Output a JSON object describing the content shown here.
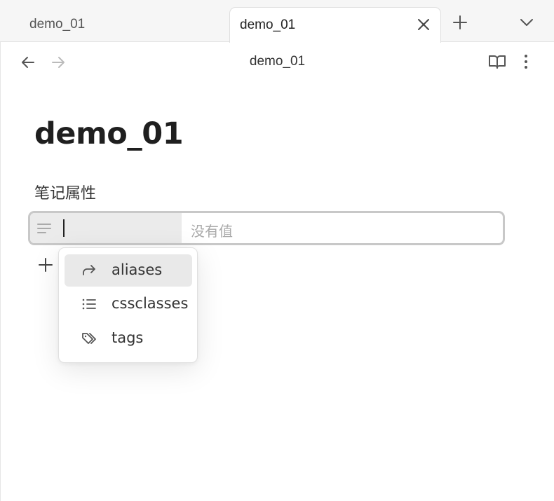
{
  "tabs": [
    {
      "label": "demo_01",
      "active": false
    },
    {
      "label": "demo_01",
      "active": true
    }
  ],
  "nav": {
    "title": "demo_01"
  },
  "note": {
    "title": "demo_01"
  },
  "properties": {
    "heading": "笔记属性",
    "key_value": "",
    "value_placeholder": "没有值"
  },
  "suggestions": [
    {
      "label": "aliases",
      "icon": "forward-arrow-icon",
      "selected": true
    },
    {
      "label": "cssclasses",
      "icon": "list-icon",
      "selected": false
    },
    {
      "label": "tags",
      "icon": "tags-icon",
      "selected": false
    }
  ],
  "colors": {
    "selected_bg": "#e9e9e9",
    "field_border": "#c8c8c8"
  }
}
